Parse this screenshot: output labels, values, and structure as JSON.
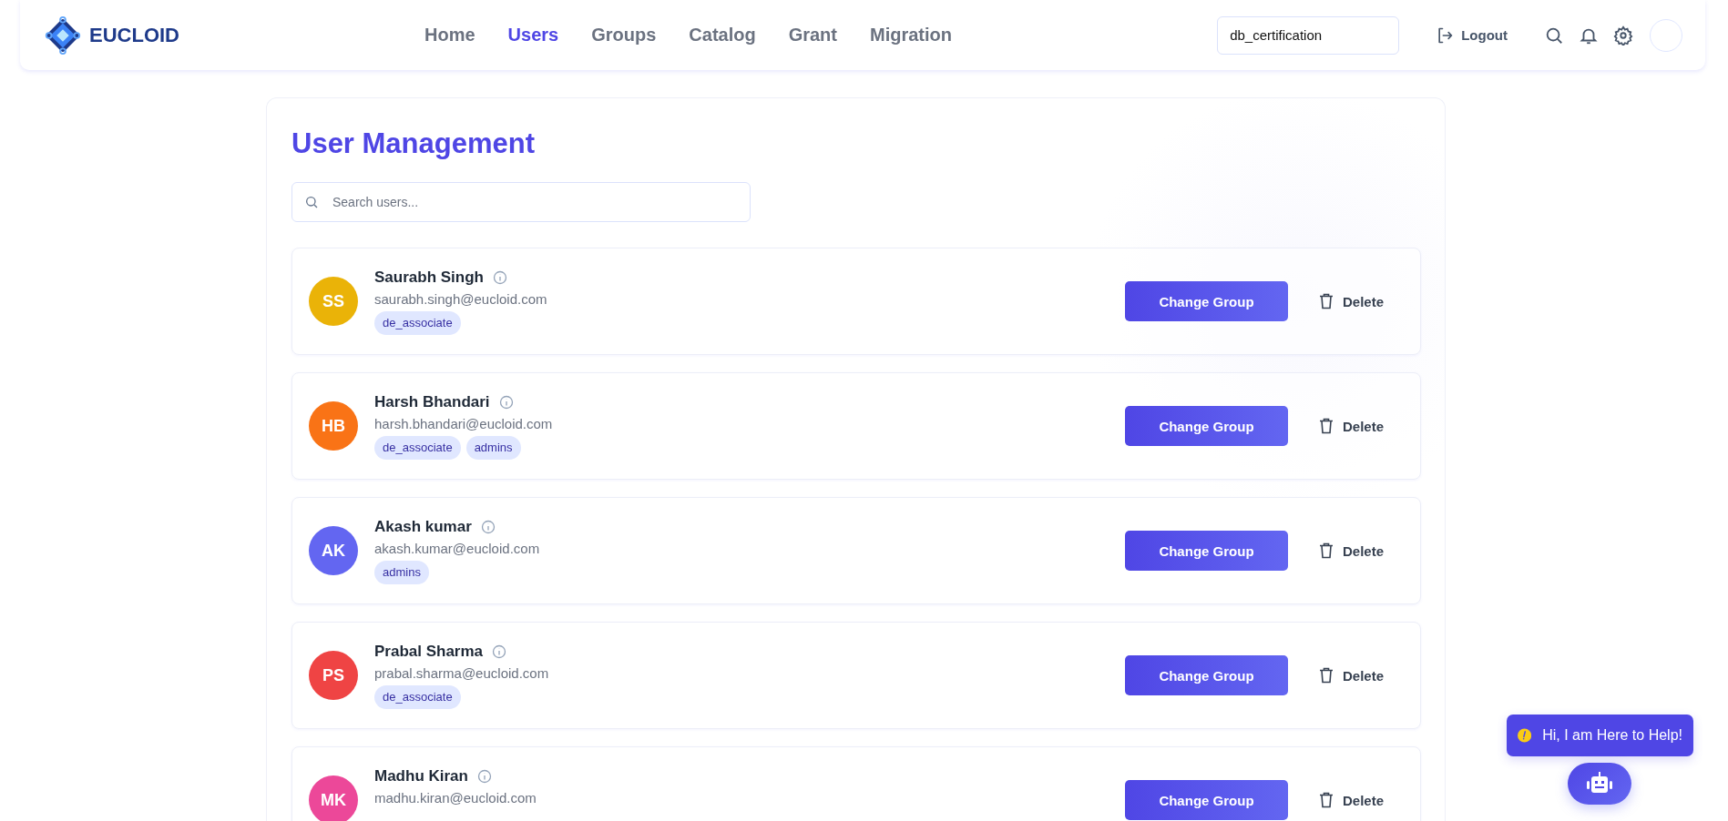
{
  "header": {
    "brand": "EUCLOID",
    "nav": [
      {
        "label": "Home",
        "selected": false
      },
      {
        "label": "Users",
        "selected": true
      },
      {
        "label": "Groups",
        "selected": false
      },
      {
        "label": "Catalog",
        "selected": false
      },
      {
        "label": "Grant",
        "selected": false
      },
      {
        "label": "Migration",
        "selected": false
      }
    ],
    "workspace": "db_certification",
    "logout": "Logout"
  },
  "page": {
    "title": "User Management",
    "search": {
      "placeholder": "Search users..."
    }
  },
  "users": [
    {
      "initials": "SS",
      "color": "#eab308",
      "name": "Saurabh Singh",
      "email": "saurabh.singh@eucloid.com",
      "groups": [
        "de_associate"
      ],
      "change": "Change Group",
      "delete": "Delete"
    },
    {
      "initials": "HB",
      "color": "#f97316",
      "name": "Harsh Bhandari",
      "email": "harsh.bhandari@eucloid.com",
      "groups": [
        "de_associate",
        "admins"
      ],
      "change": "Change Group",
      "delete": "Delete"
    },
    {
      "initials": "AK",
      "color": "#6366f1",
      "name": "Akash kumar",
      "email": "akash.kumar@eucloid.com",
      "groups": [
        "admins"
      ],
      "change": "Change Group",
      "delete": "Delete"
    },
    {
      "initials": "PS",
      "color": "#ef4444",
      "name": "Prabal Sharma",
      "email": "prabal.sharma@eucloid.com",
      "groups": [
        "de_associate"
      ],
      "change": "Change Group",
      "delete": "Delete"
    },
    {
      "initials": "MK",
      "color": "#ec4899",
      "name": "Madhu Kiran",
      "email": "madhu.kiran@eucloid.com",
      "change": "Change Group",
      "delete": "Delete"
    }
  ],
  "helper": {
    "message": "Hi, I am Here to Help!"
  }
}
